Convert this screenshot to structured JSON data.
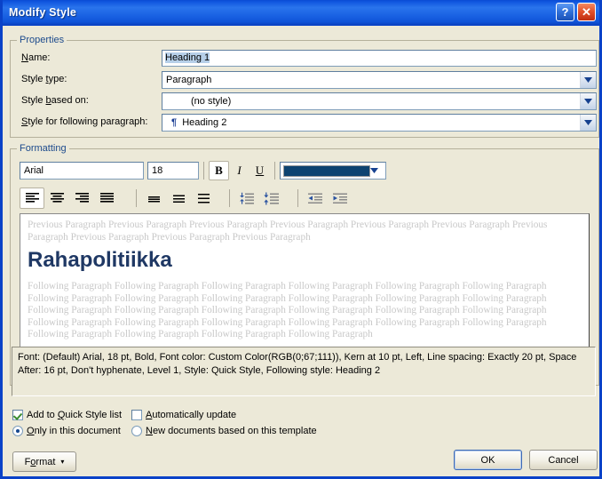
{
  "window": {
    "title": "Modify Style",
    "help_button": "?",
    "close_button": "✕"
  },
  "properties": {
    "group_label": "Properties",
    "fields": [
      {
        "label": "Name:",
        "underline": "N",
        "value": "Heading 1",
        "control": "textbox"
      },
      {
        "label": "Style type:",
        "underline": "t",
        "value": "Paragraph",
        "control": "combo"
      },
      {
        "label": "Style based on:",
        "underline": "b",
        "value": "(no style)",
        "control": "combo"
      },
      {
        "label": "Style for following paragraph:",
        "underline": "S",
        "value": "Heading 2",
        "control": "combo",
        "prefix": "¶"
      }
    ]
  },
  "formatting": {
    "group_label": "Formatting",
    "font_name": "Arial",
    "font_size": "18",
    "bold_label": "B",
    "italic_label": "I",
    "underline_label": "U",
    "font_color_hex": "#0d4370",
    "bold_active": true,
    "align_active": "left",
    "align_buttons": [
      "align-left",
      "align-center",
      "align-right",
      "align-justify"
    ],
    "line_spacing_buttons": [
      "line-spacing-single",
      "line-spacing-1.5",
      "line-spacing-double"
    ],
    "paragraph_spacing_buttons": [
      "decrease-paragraph-spacing",
      "increase-paragraph-spacing"
    ],
    "indent_buttons": [
      "decrease-indent",
      "increase-indent"
    ]
  },
  "preview": {
    "previous_paragraph": "Previous Paragraph Previous Paragraph Previous Paragraph Previous Paragraph Previous Paragraph Previous Paragraph Previous Paragraph Previous Paragraph Previous Paragraph Previous Paragraph",
    "sample_text": "Rahapolitiikka",
    "following_paragraph": "Following Paragraph Following Paragraph Following Paragraph Following Paragraph Following Paragraph Following Paragraph Following Paragraph Following Paragraph Following Paragraph Following Paragraph Following Paragraph Following Paragraph Following Paragraph Following Paragraph Following Paragraph Following Paragraph Following Paragraph Following Paragraph Following Paragraph Following Paragraph Following Paragraph Following Paragraph Following Paragraph Following Paragraph Following Paragraph Following Paragraph Following Paragraph Following Paragraph",
    "sample_color_hex": "#1f3864",
    "ghost_color_hex": "#c8c8c8"
  },
  "description": {
    "text": "Font: (Default) Arial, 18 pt, Bold, Font color: Custom Color(RGB(0;67;111)), Kern at 10 pt, Left, Line spacing:  Exactly 20 pt, Space After:  16 pt, Don't hyphenate, Level 1, Style: Quick Style, Following style: Heading 2"
  },
  "options": {
    "add_to_quick_style": {
      "label": "Add to Quick Style list",
      "underline": "Q",
      "checked": true
    },
    "automatically_update": {
      "label": "Automatically update",
      "underline": "A",
      "checked": false
    },
    "only_this_document": {
      "label": "Only in this document",
      "underline": "O",
      "selected": true
    },
    "new_documents_template": {
      "label": "New documents based on this template",
      "underline": "N",
      "selected": false
    }
  },
  "buttons": {
    "format": "Format",
    "format_caret": "▾",
    "ok": "OK",
    "cancel": "Cancel"
  }
}
